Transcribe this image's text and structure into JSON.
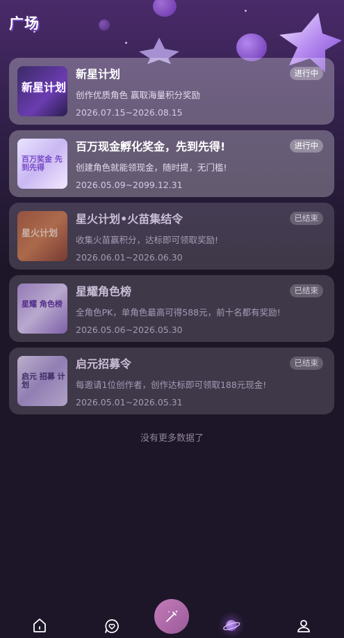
{
  "header": {
    "title": "广场"
  },
  "activities": [
    {
      "name": "新星计划",
      "desc": "创作优质角色 赢取海量积分奖励",
      "date": "2026.07.15~2026.08.15",
      "status": "进行中",
      "thumb_text": "新星计划",
      "ended": false
    },
    {
      "name": "百万现金孵化奖金，先到先得!",
      "desc": "创建角色就能领现金，随时提，无门槛!",
      "date": "2026.05.09~2099.12.31",
      "status": "进行中",
      "thumb_text": "百万奖金 先到先得",
      "ended": false
    },
    {
      "name": "星火计划•火苗集结令",
      "desc": "收集火苗赢积分，达标即可领取奖励!",
      "date": "2026.06.01~2026.06.30",
      "status": "已结束",
      "thumb_text": "星火计划",
      "ended": true
    },
    {
      "name": "星耀角色榜",
      "desc": "全角色PK，单角色最高可得588元，前十名都有奖励!",
      "date": "2026.05.06~2026.05.30",
      "status": "已结束",
      "thumb_text": "星耀 角色榜",
      "ended": true
    },
    {
      "name": "启元招募令",
      "desc": "每邀请1位创作者，创作达标即可领取188元现金!",
      "date": "2026.05.01~2026.05.31",
      "status": "已结束",
      "thumb_text": "启元 招募 计划",
      "ended": true
    }
  ],
  "footer": {
    "no_more": "没有更多数据了"
  },
  "tabbar": {
    "items": [
      "home-icon",
      "chat-heart-icon",
      "magic-wand-icon",
      "planet-icon",
      "profile-icon"
    ]
  },
  "colors": {
    "accent": "#c47bb8",
    "background": "#1d1628"
  }
}
